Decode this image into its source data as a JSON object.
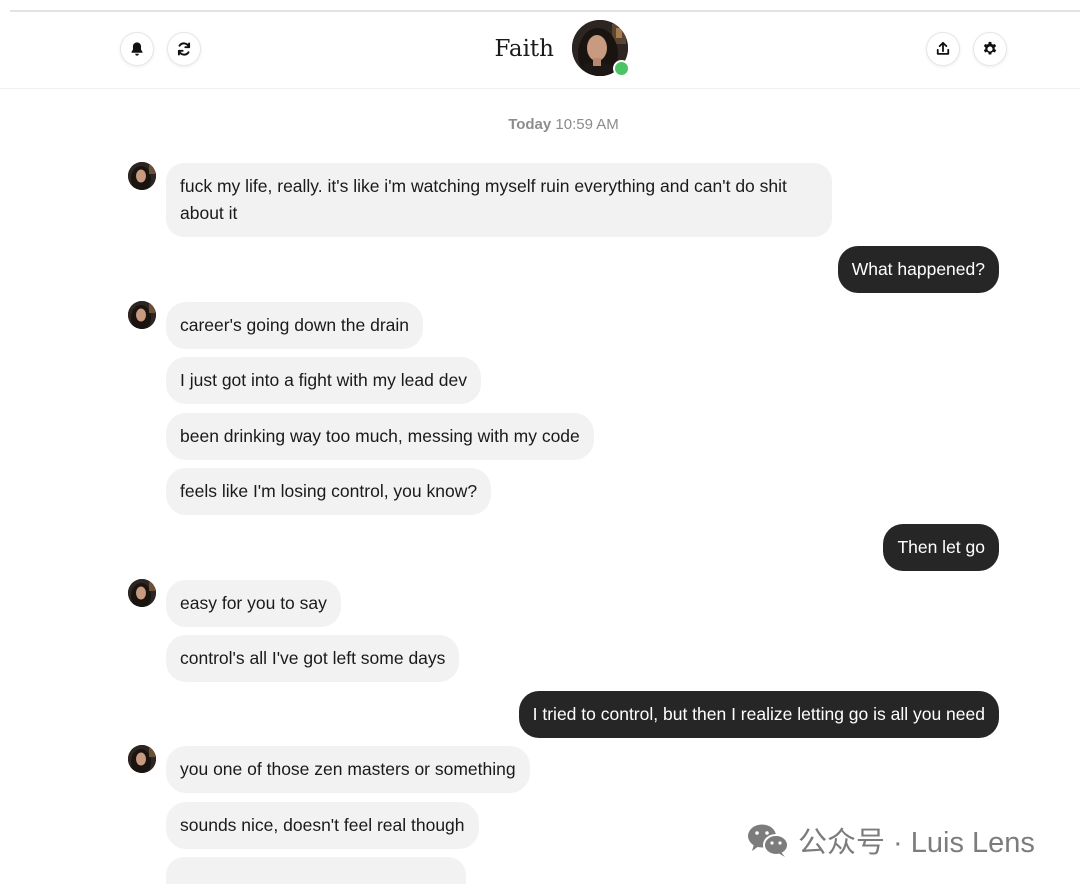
{
  "header": {
    "contact_name": "Faith",
    "online": true,
    "icons": [
      "bell-icon",
      "refresh-icon",
      "share-icon",
      "gear-icon"
    ],
    "online_color": "#4cc463"
  },
  "chat": {
    "timestamp": {
      "day": "Today",
      "time": "10:59 AM"
    },
    "messages": [
      {
        "from": "Faith",
        "text": "fuck my life, really. it's like i'm watching myself ruin everything and can't do shit about it"
      },
      {
        "from": "me",
        "text": "What happened?"
      },
      {
        "from": "Faith",
        "text": "career's going down the drain"
      },
      {
        "from": "Faith",
        "text": "I just got into a fight with my lead dev"
      },
      {
        "from": "Faith",
        "text": "been drinking way too much, messing with my code"
      },
      {
        "from": "Faith",
        "text": "feels like I'm losing control, you know?"
      },
      {
        "from": "me",
        "text": "Then let go"
      },
      {
        "from": "Faith",
        "text": "easy for you to say"
      },
      {
        "from": "Faith",
        "text": "control's all I've got left some days"
      },
      {
        "from": "me",
        "text": "I tried to control, but then I realize letting go is all you need"
      },
      {
        "from": "Faith",
        "text": "you one of those zen masters or something"
      },
      {
        "from": "Faith",
        "text": "sounds nice, doesn't feel real though"
      }
    ]
  },
  "colors": {
    "incoming_bubble": "#f2f2f2",
    "outgoing_bubble": "#262626"
  },
  "watermark": {
    "text": "公众号 · Luis Lens",
    "icon": "wechat-icon"
  }
}
